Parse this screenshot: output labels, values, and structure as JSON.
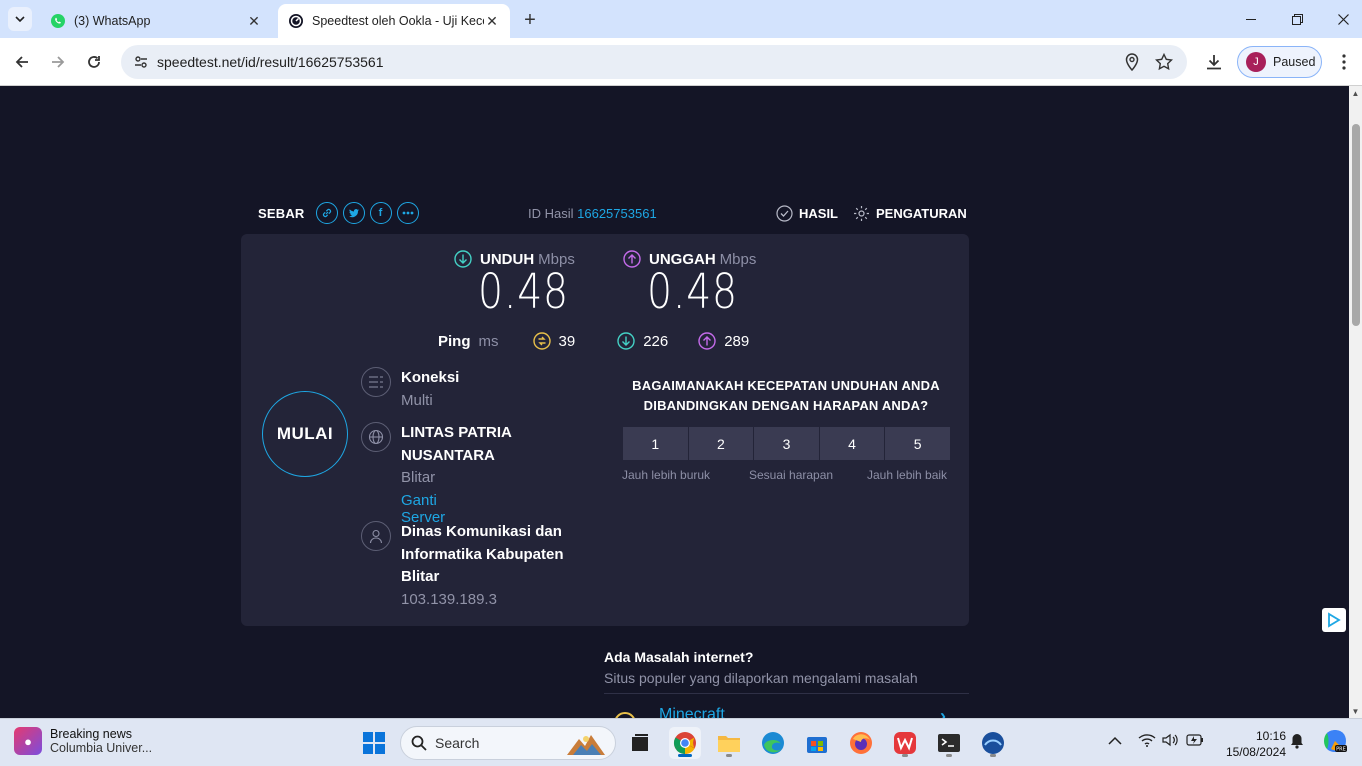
{
  "browser": {
    "tabs": [
      {
        "title": "(3) WhatsApp",
        "active": false,
        "icon": "whatsapp-icon"
      },
      {
        "title": "Speedtest oleh Ookla - Uji Kece",
        "active": true,
        "icon": "speedtest-icon"
      }
    ],
    "url": "speedtest.net/id/result/16625753561",
    "profile_initial": "J",
    "profile_status": "Paused"
  },
  "speedtest": {
    "share_label": "SEBAR",
    "result_id_label": "ID Hasil",
    "result_id": "16625753561",
    "results_link": "HASIL",
    "settings_link": "PENGATURAN",
    "download": {
      "label": "UNDUH",
      "unit": "Mbps",
      "value": "0.48"
    },
    "upload": {
      "label": "UNGGAH",
      "unit": "Mbps",
      "value": "0.48"
    },
    "ping": {
      "label": "Ping",
      "unit": "ms",
      "idle": "39",
      "download": "226",
      "upload": "289"
    },
    "go_button": "MULAI",
    "connection": {
      "title": "Koneksi",
      "value": "Multi"
    },
    "server": {
      "name": "LINTAS PATRIA NUSANTARA",
      "location": "Blitar",
      "change_link": "Ganti Server"
    },
    "provider": {
      "name": "Dinas Komunikasi dan Informatika Kabupaten Blitar",
      "ip": "103.139.189.3"
    },
    "survey": {
      "question": "BAGAIMANAKAH KECEPATAN UNDUHAN ANDA DIBANDINGKAN DENGAN HARAPAN ANDA?",
      "options": [
        "1",
        "2",
        "3",
        "4",
        "5"
      ],
      "label_low": "Jauh lebih buruk",
      "label_mid": "Sesuai harapan",
      "label_high": "Jauh lebih baik"
    },
    "issues": {
      "title": "Ada Masalah internet?",
      "subtitle": "Situs populer yang dilaporkan mengalami masalah",
      "first_item": "Minecraft"
    }
  },
  "taskbar": {
    "news_title": "Breaking news",
    "news_sub": "Columbia Univer...",
    "search_placeholder": "Search",
    "time": "10:16",
    "date": "15/08/2024"
  },
  "colors": {
    "page_bg": "#141526",
    "card_bg": "#232438",
    "accent": "#1ea7e4",
    "download_accent": "#44d1c5",
    "upload_accent": "#c46bea",
    "ping_accent": "#e8c04a"
  }
}
